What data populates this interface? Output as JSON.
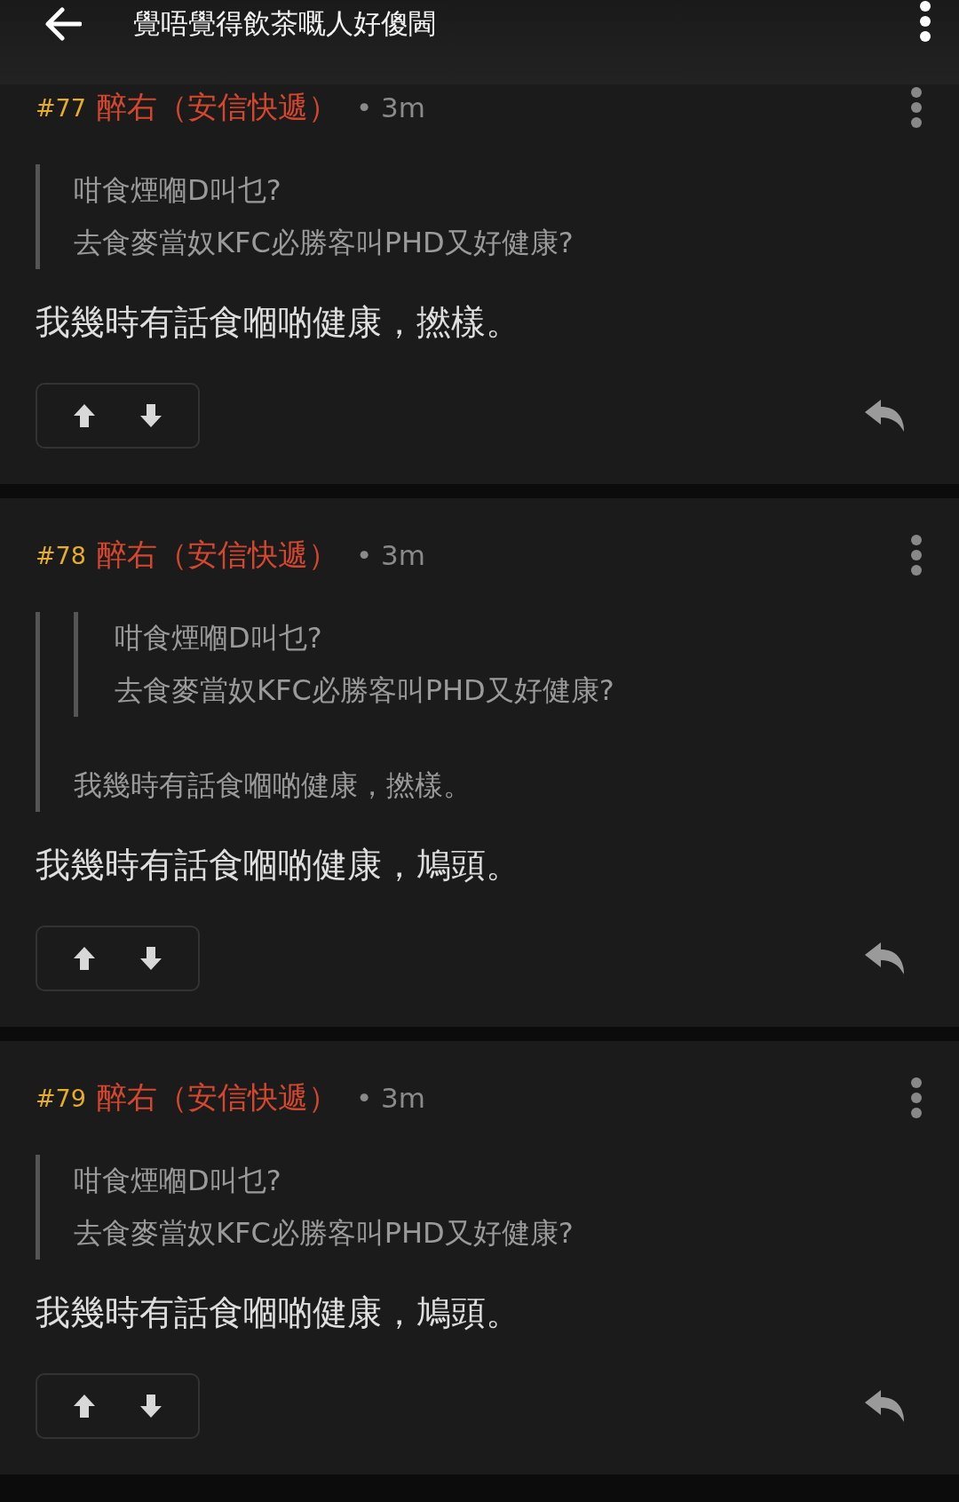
{
  "header": {
    "title": "覺唔覺得飲茶嘅人好傻閪"
  },
  "comments": [
    {
      "number": "#77",
      "author": "醉右（安信快遞）",
      "time": "• 3m",
      "quote": {
        "lines": [
          "咁食煙嗰D叫乜?",
          "去食麥當奴KFC必勝客叫PHD又好健康?"
        ]
      },
      "body": "我幾時有話食嗰啲健康，撚樣。"
    },
    {
      "number": "#78",
      "author": "醉右（安信快遞）",
      "time": "• 3m",
      "quote": {
        "quote": {
          "lines": [
            "咁食煙嗰D叫乜?",
            "去食麥當奴KFC必勝客叫PHD又好健康?"
          ]
        },
        "lines": [
          "我幾時有話食嗰啲健康，撚樣。"
        ]
      },
      "body": "我幾時有話食嗰啲健康，鳩頭。"
    },
    {
      "number": "#79",
      "author": "醉右（安信快遞）",
      "time": "• 3m",
      "quote": {
        "lines": [
          "咁食煙嗰D叫乜?",
          "去食麥當奴KFC必勝客叫PHD又好健康?"
        ]
      },
      "body": "我幾時有話食嗰啲健康，鳩頭。"
    }
  ]
}
